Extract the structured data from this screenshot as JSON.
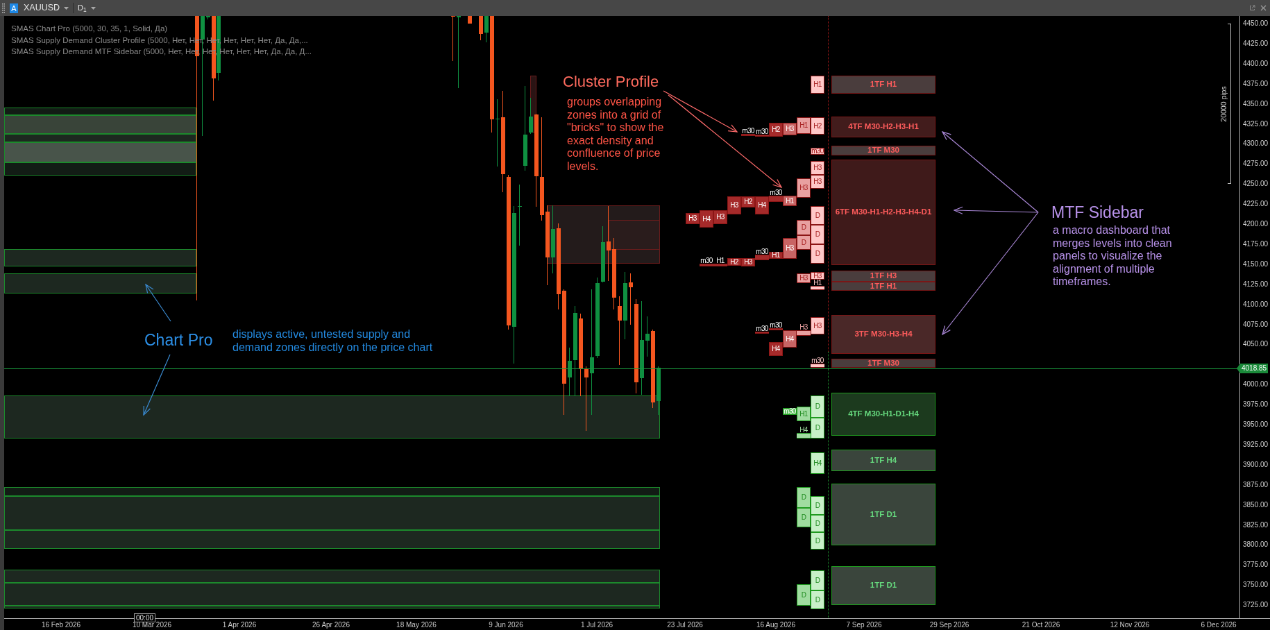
{
  "toolbar": {
    "symbol_badge": "A",
    "symbol": "XAUUSD",
    "timeframe": "D$_{1}$"
  },
  "indicators": [
    "SMAS Chart Pro (5000, 30, 35, 1, Solid, Да)",
    "SMAS Supply Demand Cluster Profile (5000, Нет, Нет, Нет, Нет, Нет, Нет, Да, Да,...",
    "SMAS Supply Demand MTF Sidebar (5000, Нет, Нет, Нет, Нет, Нет, Нет, Да, Да, Д..."
  ],
  "annotations": [
    {
      "kind": "cluster",
      "title": "Cluster Profile",
      "text": "groups overlapping zones into a grid of \"bricks\" to show the exact density and confluence of price levels."
    },
    {
      "kind": "sidebar",
      "title": "MTF Sidebar",
      "text": "a macro dashboard that merges levels into clean panels to visualize the alignment of multiple timeframes."
    },
    {
      "kind": "chartpro",
      "title": "Chart Pro",
      "text": "displays active, untested supply and demand zones directly on the price chart"
    }
  ],
  "cluster_profile": {
    "bricks": [
      {
        "label": "H1",
        "kind": "supply"
      },
      {
        "label": "H2",
        "kind": "supply"
      },
      {
        "label": "H3",
        "kind": "supply"
      },
      {
        "label": "H1",
        "kind": "supply"
      },
      {
        "label": "H2",
        "kind": "supply"
      },
      {
        "label": "m30",
        "kind": "supply"
      },
      {
        "label": "m30",
        "kind": "supply"
      },
      {
        "label": "m30",
        "kind": "supply"
      },
      {
        "label": "H3",
        "kind": "supply"
      },
      {
        "label": "H3",
        "kind": "supply"
      },
      {
        "label": "H3",
        "kind": "supply"
      },
      {
        "label": "H3",
        "kind": "supply"
      },
      {
        "label": "H2",
        "kind": "supply"
      },
      {
        "label": "H4",
        "kind": "supply"
      },
      {
        "label": "m30",
        "kind": "supply"
      },
      {
        "label": "H1",
        "kind": "supply"
      },
      {
        "label": "H3",
        "kind": "supply"
      },
      {
        "label": "H4",
        "kind": "supply"
      },
      {
        "label": "H3",
        "kind": "supply"
      },
      {
        "label": "D",
        "kind": "supply"
      },
      {
        "label": "D",
        "kind": "supply"
      },
      {
        "label": "D",
        "kind": "supply"
      },
      {
        "label": "H3",
        "kind": "supply"
      },
      {
        "label": "D",
        "kind": "supply"
      },
      {
        "label": "D",
        "kind": "supply"
      },
      {
        "label": "m30",
        "kind": "supply"
      },
      {
        "label": "H1",
        "kind": "supply"
      },
      {
        "label": "H2",
        "kind": "supply"
      },
      {
        "label": "H3",
        "kind": "supply"
      },
      {
        "label": "m30",
        "kind": "supply"
      },
      {
        "label": "H1",
        "kind": "supply"
      },
      {
        "label": "H3",
        "kind": "supply"
      },
      {
        "label": "H3",
        "kind": "supply"
      },
      {
        "label": "H1",
        "kind": "supply"
      },
      {
        "label": "H3",
        "kind": "supply"
      },
      {
        "label": "m30",
        "kind": "supply"
      },
      {
        "label": "m30",
        "kind": "supply"
      },
      {
        "label": "H4",
        "kind": "supply"
      },
      {
        "label": "H3",
        "kind": "supply"
      },
      {
        "label": "H4",
        "kind": "supply"
      },
      {
        "label": "m30",
        "kind": "supply"
      },
      {
        "label": "D",
        "kind": "demand"
      },
      {
        "label": "m30",
        "kind": "demand"
      },
      {
        "label": "H1",
        "kind": "demand"
      },
      {
        "label": "D",
        "kind": "demand"
      },
      {
        "label": "H4",
        "kind": "demand"
      },
      {
        "label": "H4",
        "kind": "demand"
      },
      {
        "label": "D",
        "kind": "demand"
      },
      {
        "label": "D",
        "kind": "demand"
      },
      {
        "label": "D",
        "kind": "demand"
      },
      {
        "label": "D",
        "kind": "demand"
      },
      {
        "label": "D",
        "kind": "demand"
      },
      {
        "label": "D",
        "kind": "demand"
      },
      {
        "label": "D",
        "kind": "demand"
      },
      {
        "label": "D",
        "kind": "demand"
      }
    ]
  },
  "mtf_sidebar": {
    "panels": [
      {
        "label": "1TF H1",
        "kind": "supply",
        "color": "#4a3d3d"
      },
      {
        "label": "4TF M30-H2-H3-H1",
        "kind": "supply",
        "color": "#421c1c"
      },
      {
        "label": "1TF M30",
        "kind": "supply",
        "color": "#4a3d3d"
      },
      {
        "label": "6TF M30-H1-H2-H3-H4-D1",
        "kind": "supply",
        "color": "#3f1a1a"
      },
      {
        "label": "1TF H3",
        "kind": "supply",
        "color": "#4a3d3d"
      },
      {
        "label": "1TF H1",
        "kind": "supply",
        "color": "#4a3d3d"
      },
      {
        "label": "3TF M30-H3-H4",
        "kind": "supply",
        "color": "#4a2828"
      },
      {
        "label": "1TF M30",
        "kind": "supply",
        "color": "#4a3d3d"
      },
      {
        "label": "4TF M30-H1-D1-H4",
        "kind": "demand",
        "color": "#1c3a1e"
      },
      {
        "label": "1TF H4",
        "kind": "demand",
        "color": "#3a453c"
      },
      {
        "label": "1TF D1",
        "kind": "demand",
        "color": "#3a453c"
      },
      {
        "label": "1TF D1",
        "kind": "demand",
        "color": "#3a453c"
      }
    ]
  },
  "price_axis": {
    "labels": [
      "4450.00",
      "4425.00",
      "4400.00",
      "4375.00",
      "4350.00",
      "4325.00",
      "4300.00",
      "4275.00",
      "4250.00",
      "4225.00",
      "4200.00",
      "4175.00",
      "4150.00",
      "4125.00",
      "4100.00",
      "4075.00",
      "4050.00",
      "4000.00",
      "3975.00",
      "3950.00",
      "3925.00",
      "3900.00",
      "3875.00",
      "3850.00",
      "3825.00",
      "3800.00",
      "3775.00",
      "3750.00",
      "3725.00"
    ],
    "current_price": "4018.85",
    "range_label": "20000 pips"
  },
  "time_axis": {
    "labels": [
      "16 Feb 2026",
      "10 Mar 2026",
      "1 Apr 2026",
      "26 Apr 2026",
      "18 May 2026",
      "9 Jun 2026",
      "1 Jul 2026",
      "23 Jul 2026",
      "16 Aug 2026",
      "7 Sep 2026",
      "29 Sep 2026",
      "21 Oct 2026",
      "12 Nov 2026",
      "6 Dec 2026"
    ],
    "cursor_label": "00:00"
  }
}
